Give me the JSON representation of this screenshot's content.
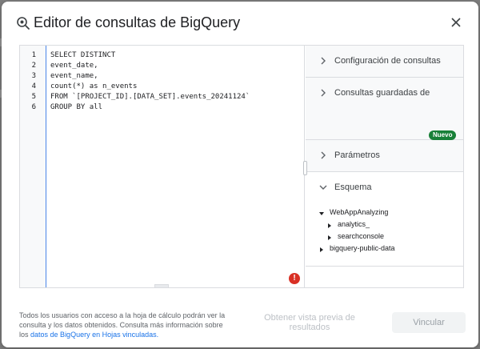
{
  "dialog": {
    "title": "Editor de consultas de BigQuery",
    "title_icon": "search-query-icon",
    "close_icon": "close-icon"
  },
  "editor": {
    "line_numbers": [
      "1",
      "2",
      "3",
      "4",
      "5",
      "6"
    ],
    "lines": [
      "SELECT DISTINCT",
      "event_date,",
      "event_name,",
      "count(*) as n_events",
      "FROM `[PROJECT_ID].[DATA_SET].events_20241124`",
      "GROUP BY all"
    ],
    "error_badge": "!"
  },
  "sidebar": {
    "sections": [
      {
        "label": "Configuración de consultas",
        "expanded": false
      },
      {
        "label": "Consultas guardadas de",
        "expanded": false,
        "badge": "Nuevo"
      },
      {
        "label": "Parámetros",
        "expanded": false
      },
      {
        "label": "Esquema",
        "expanded": true
      }
    ],
    "schema_tree": [
      {
        "label": "WebAppAnalyzing",
        "level": 0,
        "expanded": true
      },
      {
        "label": "analytics_",
        "level": 1,
        "expanded": false
      },
      {
        "label": "searchconsole",
        "level": 1,
        "expanded": false
      },
      {
        "label": "bigquery-public-data",
        "level": 0,
        "expanded": false
      }
    ]
  },
  "footer": {
    "notice_text": "Todos los usuarios con acceso a la hoja de cálculo podrán ver la consulta y los datos obtenidos. Consulta más información sobre los",
    "notice_link": "datos de BigQuery en Hojas vinculadas.",
    "preview_button": "Obtener vista previa de resultados",
    "connect_button": "Vincular"
  },
  "colors": {
    "accent": "#1a73e8",
    "badge": "#188038",
    "error": "#d93025"
  }
}
